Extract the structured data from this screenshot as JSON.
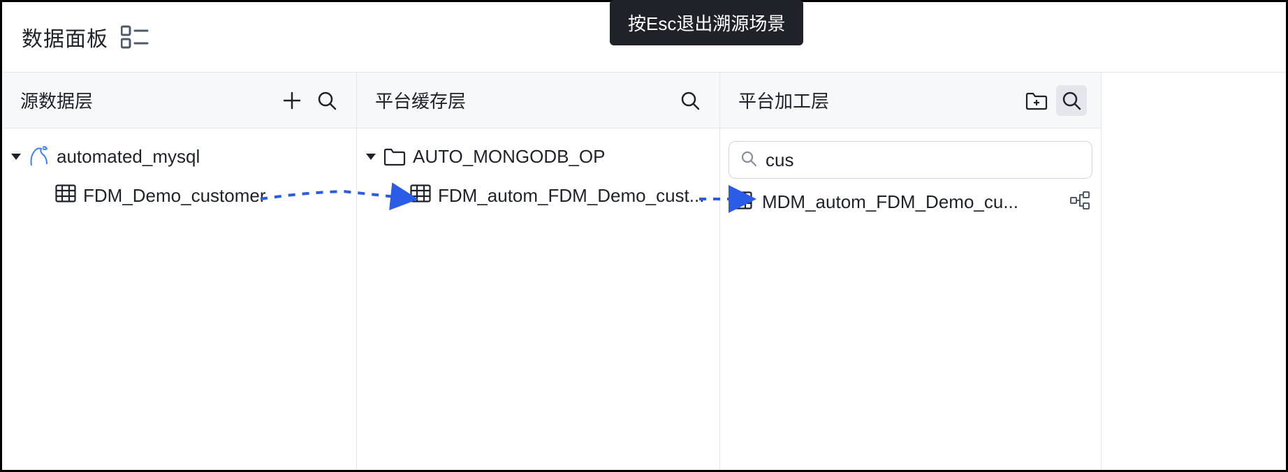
{
  "header": {
    "title": "数据面板",
    "tooltip": "按Esc退出溯源场景"
  },
  "columns": {
    "source": {
      "title": "源数据层",
      "db_name": "automated_mysql",
      "table_name": "FDM_Demo_customer"
    },
    "cache": {
      "title": "平台缓存层",
      "folder_name": "AUTO_MONGODB_OP",
      "table_name": "FDM_autom_FDM_Demo_cust..."
    },
    "process": {
      "title": "平台加工层",
      "search_value": "cus",
      "table_name": "MDM_autom_FDM_Demo_cu..."
    }
  }
}
